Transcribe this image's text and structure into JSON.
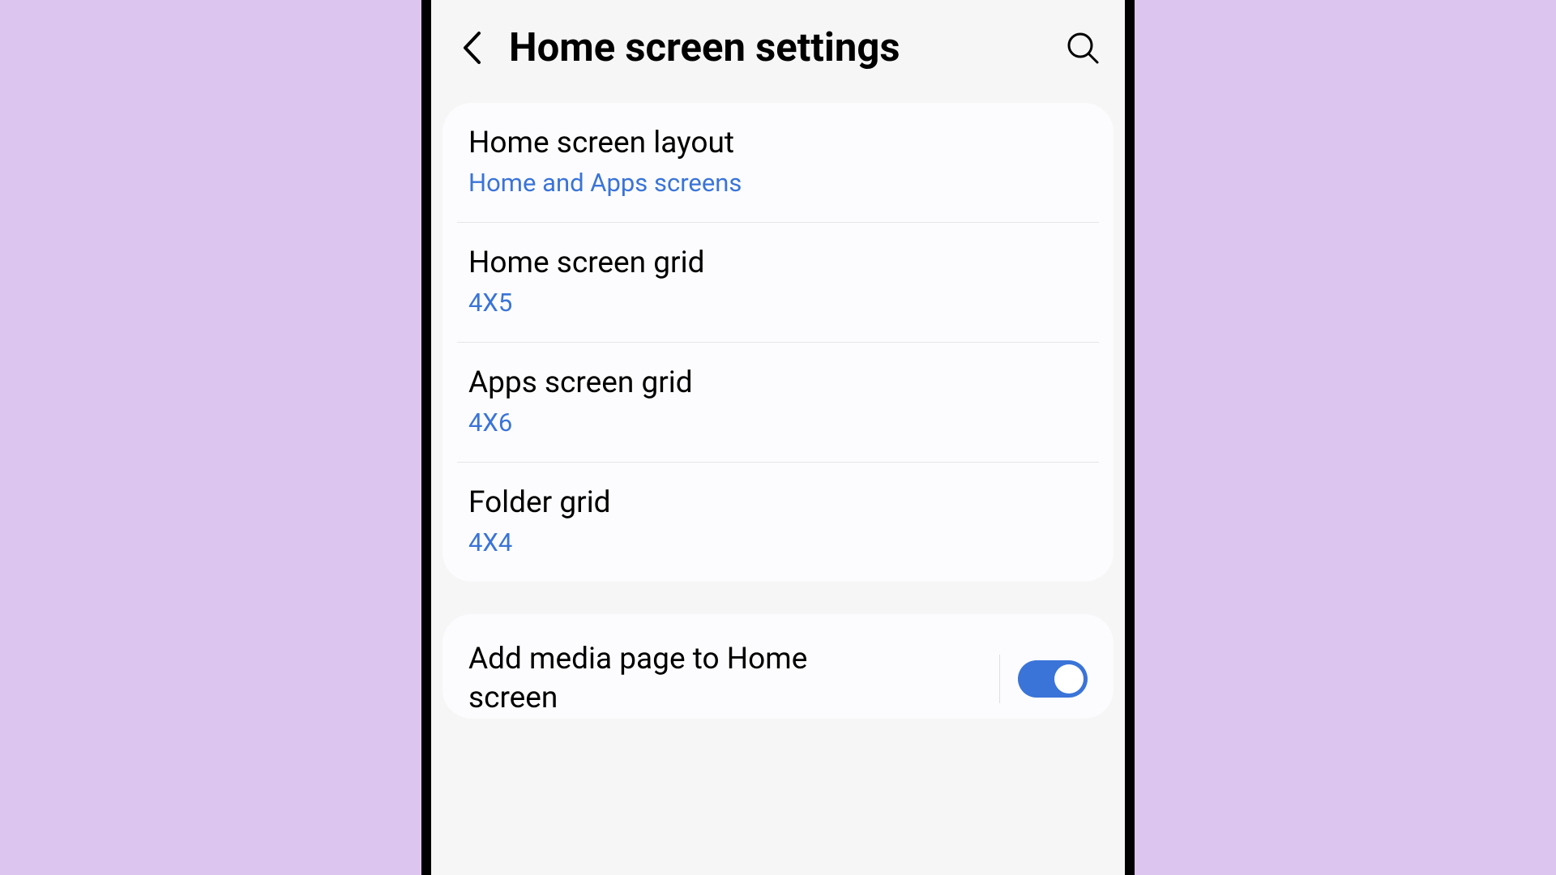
{
  "header": {
    "title": "Home screen settings"
  },
  "items": [
    {
      "title": "Home screen layout",
      "sub": "Home and Apps screens"
    },
    {
      "title": "Home screen grid",
      "sub": "4X5"
    },
    {
      "title": "Apps screen grid",
      "sub": "4X6"
    },
    {
      "title": "Folder grid",
      "sub": "4X4"
    }
  ],
  "toggle": {
    "title": "Add media page to Home screen",
    "on": true
  }
}
